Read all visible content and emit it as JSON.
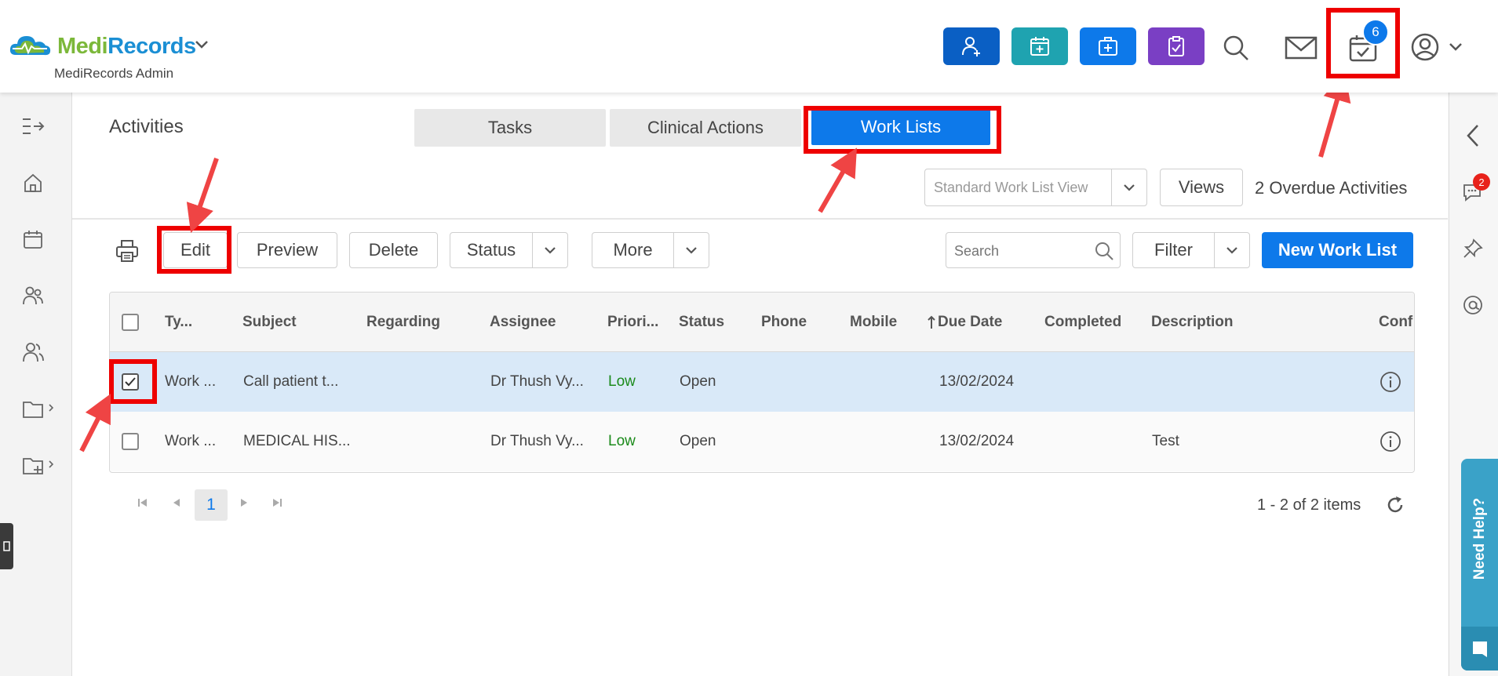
{
  "header": {
    "brand_medi": "Medi",
    "brand_records": "Records",
    "sub_brand": "MediRecords Admin",
    "quick_buttons": [
      {
        "icon": "add-patient-icon",
        "color": "#0a5fc4"
      },
      {
        "icon": "calendar-add-icon",
        "color": "#1fa3b0"
      },
      {
        "icon": "medical-kit-icon",
        "color": "#0d79ea"
      },
      {
        "icon": "clipboard-check-icon",
        "color": "#7a3fc4"
      }
    ],
    "activities_badge": "6"
  },
  "page": {
    "title": "Activities",
    "tabs": [
      {
        "label": "Tasks",
        "active": false
      },
      {
        "label": "Clinical Actions",
        "active": false
      },
      {
        "label": "Work Lists",
        "active": true
      }
    ],
    "view_select_placeholder": "Standard Work List View",
    "views_label": "Views",
    "overdue_text": "2 Overdue Activities"
  },
  "toolbar": {
    "edit_label": "Edit",
    "preview_label": "Preview",
    "delete_label": "Delete",
    "status_label": "Status",
    "more_label": "More",
    "search_placeholder": "Search",
    "filter_label": "Filter",
    "new_label": "New Work List"
  },
  "grid": {
    "columns": [
      "Ty...",
      "Subject",
      "Regarding",
      "Assignee",
      "Priori...",
      "Status",
      "Phone",
      "Mobile",
      "Due Date",
      "Completed",
      "Description",
      "Conf"
    ],
    "rows": [
      {
        "type": "Work ...",
        "subject": "Call patient t...",
        "regarding": "",
        "assignee": "Dr Thush Vy...",
        "priority": "Low",
        "status": "Open",
        "phone": "",
        "mobile": "",
        "due": "13/02/2024",
        "completed": "",
        "description": "",
        "checked": true
      },
      {
        "type": "Work ...",
        "subject": "MEDICAL HIS...",
        "regarding": "",
        "assignee": "Dr Thush Vy...",
        "priority": "Low",
        "status": "Open",
        "phone": "",
        "mobile": "",
        "due": "13/02/2024",
        "completed": "",
        "description": "Test",
        "checked": false
      }
    ]
  },
  "pagination": {
    "current_page": "1",
    "summary": "1 - 2 of 2 items"
  },
  "right_panel": {
    "chat_badge": "2",
    "need_help": "Need Help?"
  }
}
